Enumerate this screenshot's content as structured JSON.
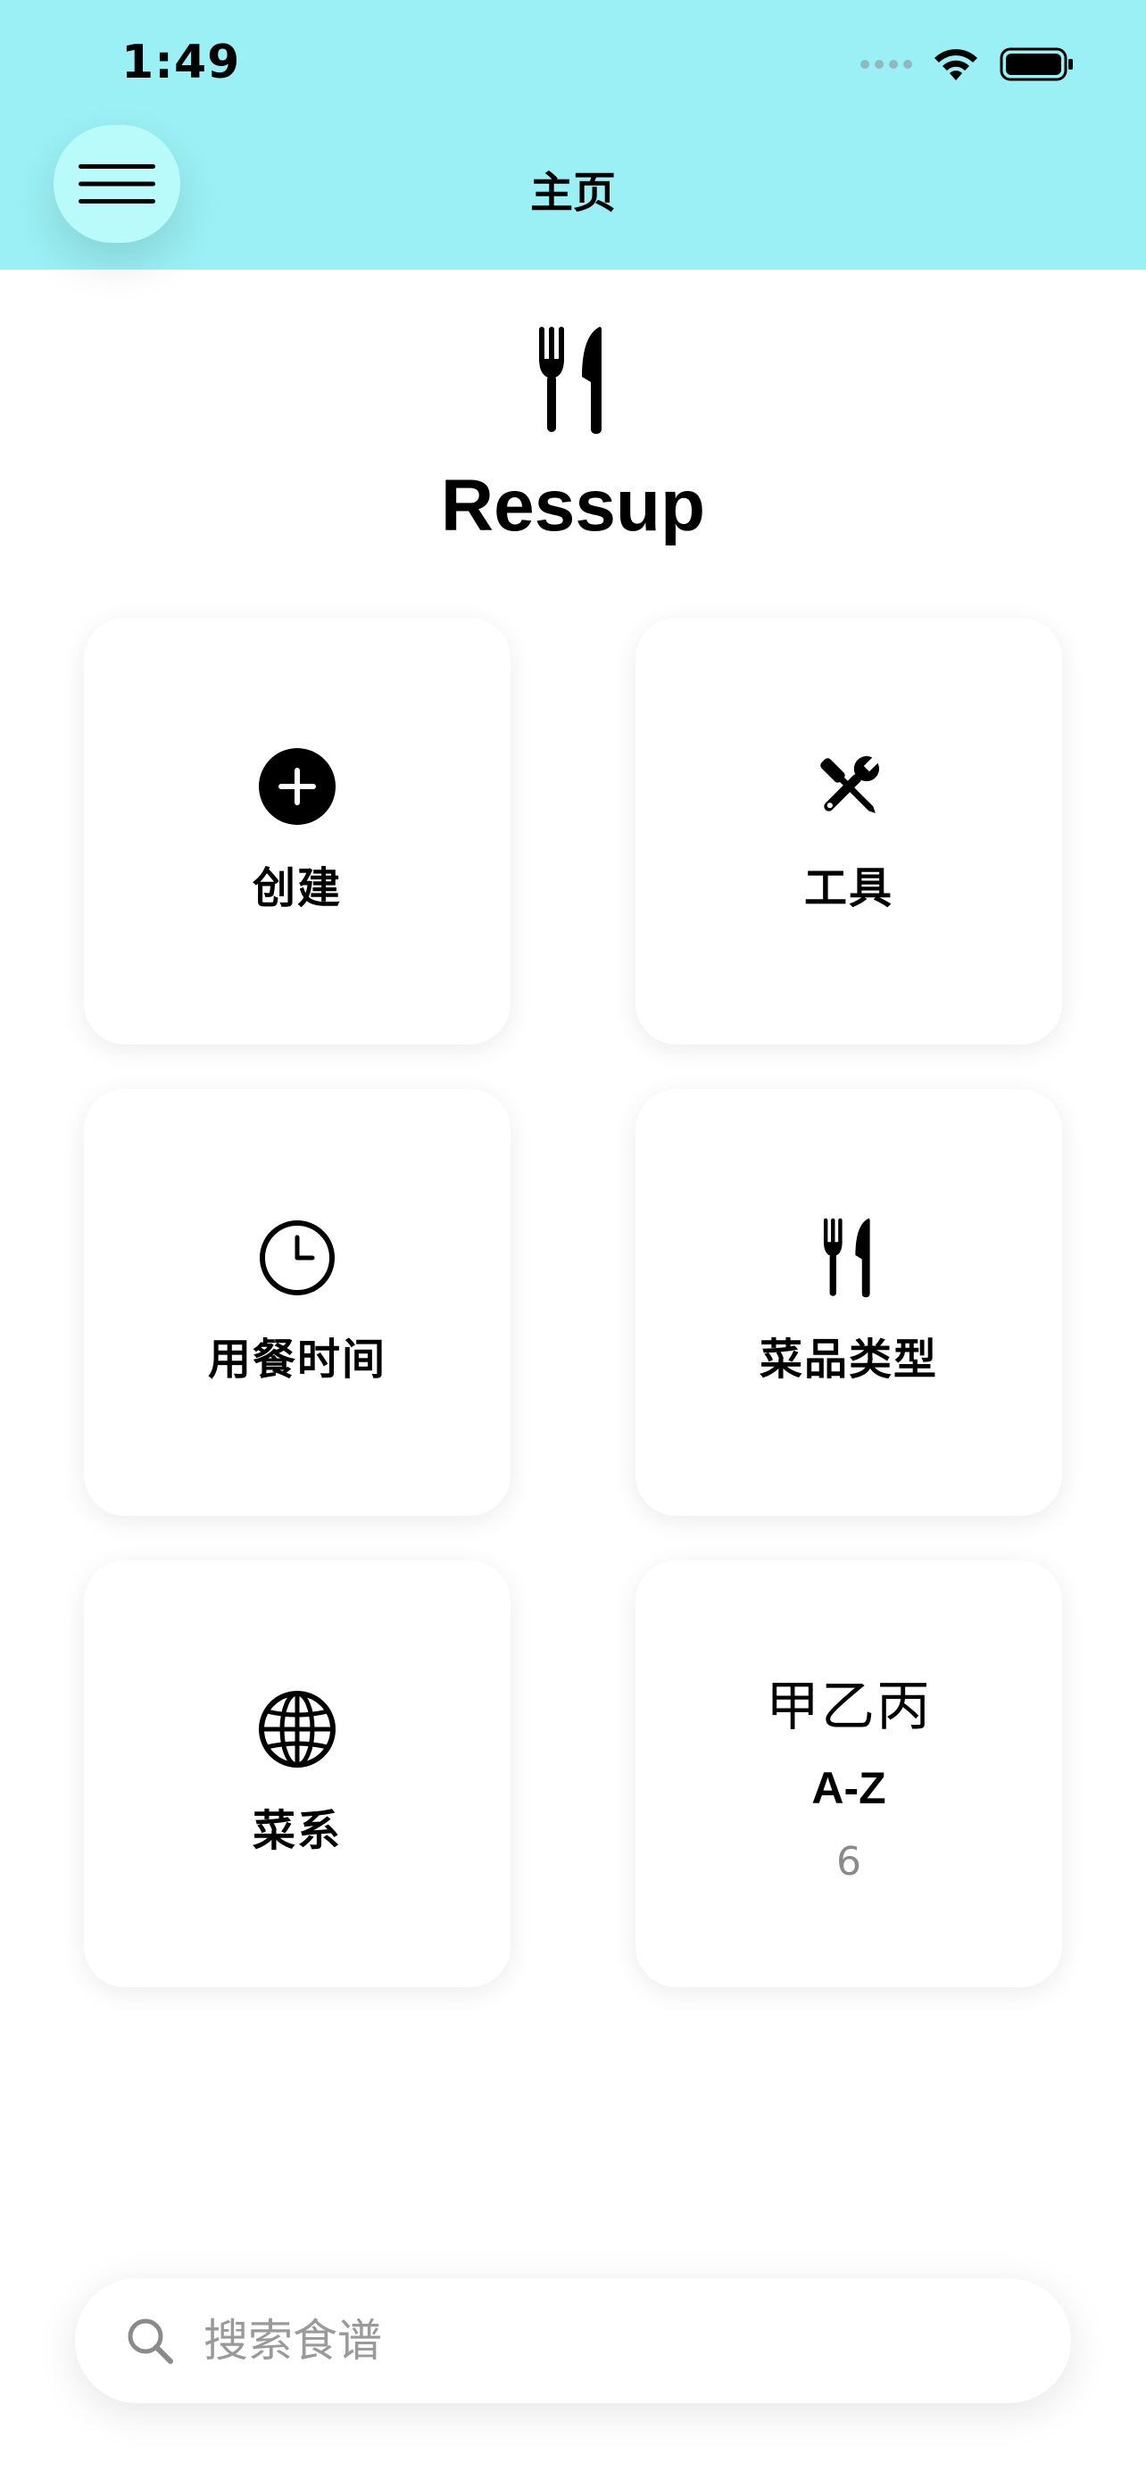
{
  "status_bar": {
    "time": "1:49"
  },
  "header": {
    "title": "主页",
    "menu_icon": "hamburger-icon"
  },
  "brand": {
    "icon": "fork-knife-icon",
    "name": "Ressup"
  },
  "cards": {
    "create": {
      "label": "创建",
      "icon": "plus-circle-icon"
    },
    "tools": {
      "label": "工具",
      "icon": "tools-icon"
    },
    "meal_time": {
      "label": "用餐时间",
      "icon": "clock-icon"
    },
    "dish_type": {
      "label": "菜品类型",
      "icon": "fork-knife-icon"
    },
    "cuisine": {
      "label": "菜系",
      "icon": "globe-icon"
    },
    "az": {
      "title": "甲乙丙",
      "subtitle": "A-Z",
      "count": "6"
    }
  },
  "search": {
    "placeholder": "搜索食谱",
    "value": ""
  },
  "colors": {
    "header_bg": "#9af0f4",
    "menu_button_bg": "#b9fbfb",
    "muted_text": "#8a8a8a"
  }
}
